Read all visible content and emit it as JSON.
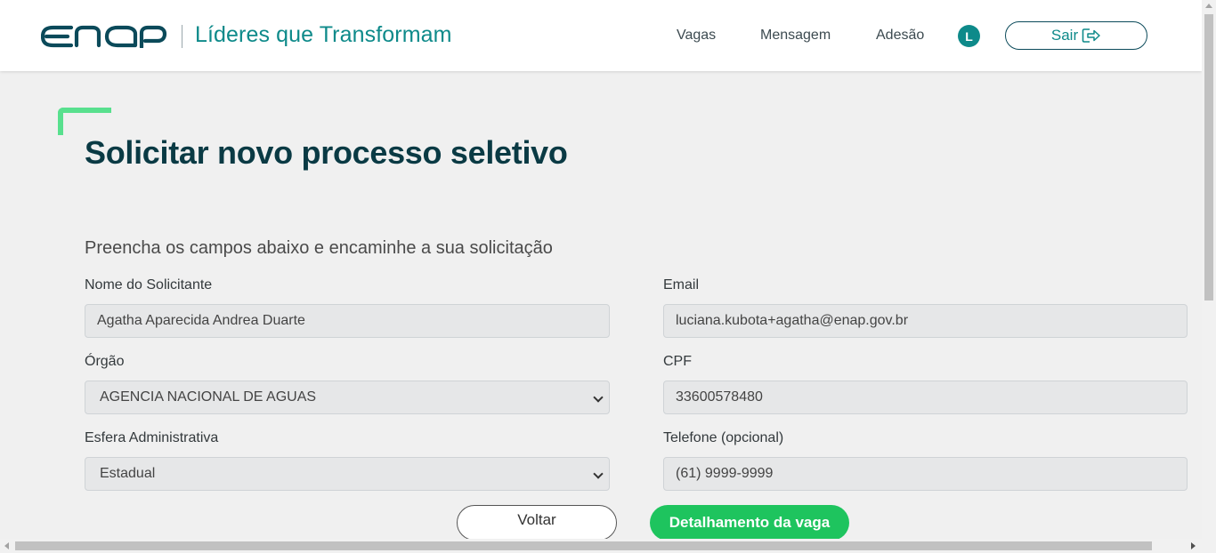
{
  "header": {
    "brand_title": "Líderes que Transformam",
    "nav": {
      "vagas": "Vagas",
      "mensagem": "Mensagem",
      "adesao": "Adesão"
    },
    "avatar_initial": "L",
    "logout_label": "Sair"
  },
  "page": {
    "title": "Solicitar novo processo seletivo",
    "subtitle": "Preencha os campos abaixo e encaminhe a sua solicitação"
  },
  "form": {
    "nome": {
      "label": "Nome do Solicitante",
      "value": "Agatha Aparecida Andrea Duarte"
    },
    "email": {
      "label": "Email",
      "value": "luciana.kubota+agatha@enap.gov.br"
    },
    "orgao": {
      "label": "Órgão",
      "value": "AGENCIA NACIONAL DE AGUAS"
    },
    "cpf": {
      "label": "CPF",
      "value": "33600578480"
    },
    "esfera": {
      "label": "Esfera Administrativa",
      "value": "Estadual"
    },
    "telefone": {
      "label": "Telefone (opcional)",
      "placeholder": "(61) 9999-9999"
    }
  },
  "actions": {
    "voltar": "Voltar",
    "detalhamento": "Detalhamento da vaga"
  },
  "colors": {
    "brand_teal": "#0e8a8a",
    "title_dark": "#0a3a44",
    "accent_green": "#58e08e",
    "button_green": "#1ec45e"
  },
  "icons": {
    "logout": "logout-arrow-icon",
    "select": "chevron-down-icon"
  }
}
